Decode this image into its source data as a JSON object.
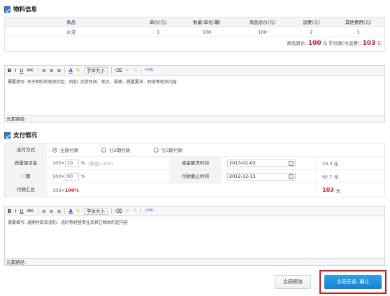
{
  "material_section": {
    "title": "物料信息",
    "headers": [
      "商品",
      "单价(元)",
      "数量(单位:罐)",
      "商品总价(元)",
      "运费(元)",
      "其他费用(元)"
    ],
    "row": [
      "水泥",
      "1",
      "100",
      "100",
      "2",
      "1"
    ],
    "total_label_a": "商品原价:",
    "total_value_a": "100",
    "total_unit_a": "元",
    "total_label_b": "实付款(含运费):",
    "total_value_b": "103",
    "total_unit_b": "元"
  },
  "editor1": {
    "toolbar": {
      "bold": "B",
      "italic": "I",
      "underline": "U",
      "strike": "ABC",
      "font_size": "字体大小",
      "html": "HTML"
    },
    "content": "需要填写: 关于物料的相关约定、例如: 交货时间、地点、规格、质量要求、验收等相关内容",
    "footer": "元素路径:"
  },
  "payment_section": {
    "title": "支付情况",
    "method_label": "支付方式",
    "options": [
      "全额付款",
      "分2期付款",
      "分3期付款"
    ],
    "deposit_label": "质量保证金",
    "deposit_base": "103×",
    "deposit_value": "10",
    "deposit_pct": "%",
    "deposit_hint": "(数值>100)",
    "release_label": "资金解冻时间",
    "release_date": "2013-01-03",
    "deposit_amount": "10.3 元",
    "period1_label": "一期",
    "period1_base": "103×",
    "period1_value": "90",
    "period1_pct": "%",
    "deadline_label": "付款截止时间",
    "deadline_date": "2012-12-13",
    "period1_amount": "92.7 元",
    "summary_label": "付款汇总",
    "summary_base": "103×",
    "summary_pct": "100%",
    "summary_amount": "103",
    "summary_unit": "元"
  },
  "editor2": {
    "toolbar": {
      "bold": "B",
      "italic": "I",
      "underline": "U",
      "strike": "ABC",
      "font_size": "字体大小",
      "html": "HTML"
    },
    "content": "需要填写: 逾期付款及违约、违约等经营责任及其它相关约定内容",
    "footer": "元素路径:"
  },
  "actions": {
    "preview": "合同预览",
    "confirm": "合同无误, 确认"
  },
  "colors": {
    "accent": "#1582d0",
    "highlight": "#d9161c"
  }
}
